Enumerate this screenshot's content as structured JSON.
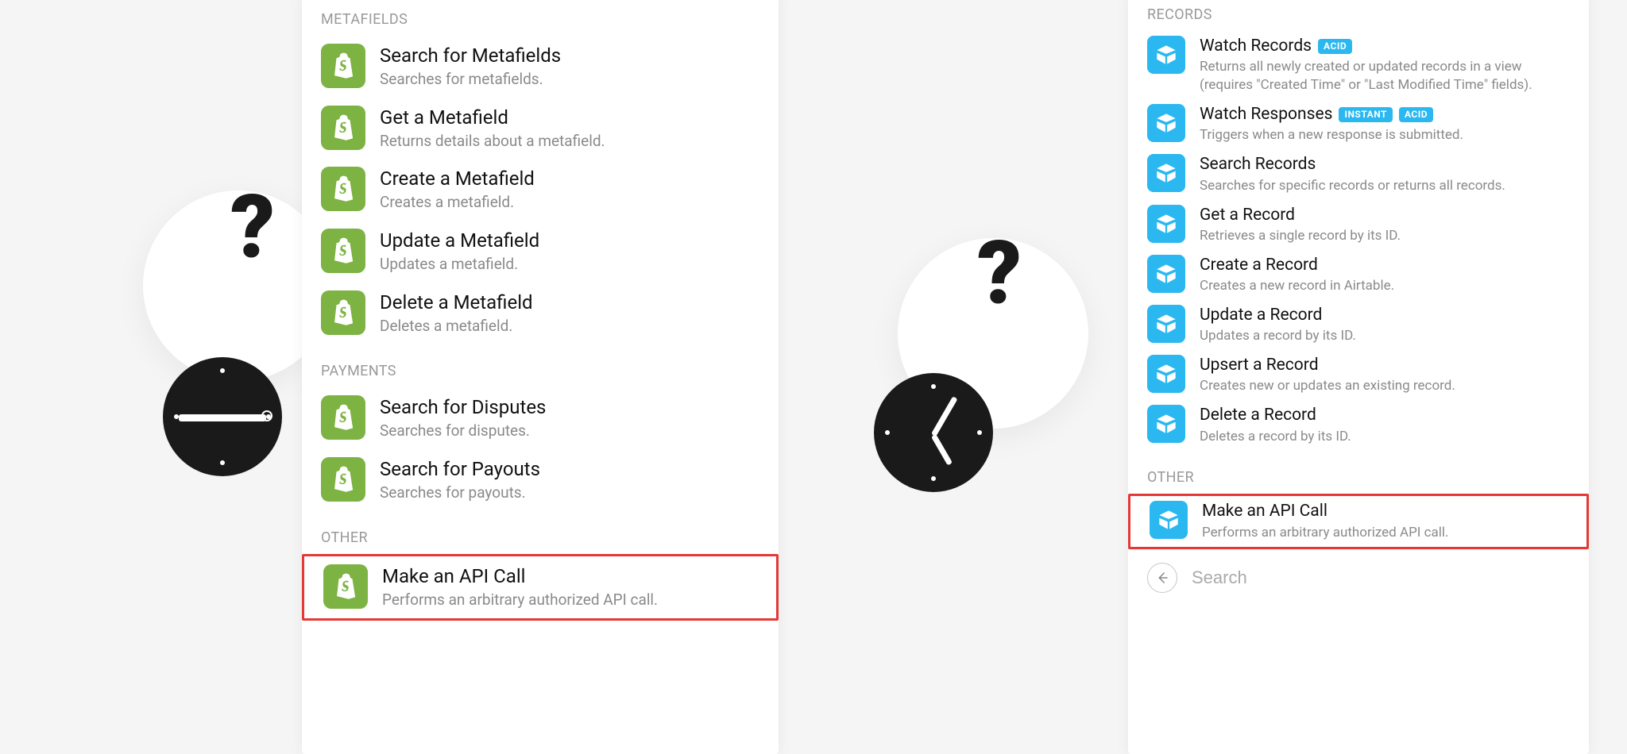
{
  "left_panel": {
    "sections": [
      {
        "label": "METAFIELDS",
        "items": [
          {
            "title": "Search for Metafields",
            "desc": "Searches for metafields."
          },
          {
            "title": "Get a Metafield",
            "desc": "Returns details about a metafield."
          },
          {
            "title": "Create a Metafield",
            "desc": "Creates a metafield."
          },
          {
            "title": "Update a Metafield",
            "desc": "Updates a metafield."
          },
          {
            "title": "Delete a Metafield",
            "desc": "Deletes a metafield."
          }
        ]
      },
      {
        "label": "PAYMENTS",
        "items": [
          {
            "title": "Search for Disputes",
            "desc": "Searches for disputes."
          },
          {
            "title": "Search for Payouts",
            "desc": "Searches for payouts."
          }
        ]
      },
      {
        "label": "OTHER",
        "items": [
          {
            "title": "Make an API Call",
            "desc": "Performs an arbitrary authorized API call.",
            "highlighted": true
          }
        ]
      }
    ]
  },
  "right_panel": {
    "sections": [
      {
        "label": "RECORDS",
        "items": [
          {
            "title": "Watch Records",
            "badges": [
              "ACID"
            ],
            "desc": "Returns all newly created or updated records in a view (requires \"Created Time\" or \"Last Modified Time\" fields)."
          },
          {
            "title": "Watch Responses",
            "badges": [
              "INSTANT",
              "ACID"
            ],
            "desc": "Triggers when a new response is submitted."
          },
          {
            "title": "Search Records",
            "desc": "Searches for specific records or returns all records."
          },
          {
            "title": "Get a Record",
            "desc": "Retrieves a single record by its ID."
          },
          {
            "title": "Create a Record",
            "desc": "Creates a new record in Airtable."
          },
          {
            "title": "Update a Record",
            "desc": "Updates a record by its ID."
          },
          {
            "title": "Upsert a Record",
            "desc": "Creates new or updates an existing record."
          },
          {
            "title": "Delete a Record",
            "desc": "Deletes a record by its ID."
          }
        ]
      },
      {
        "label": "OTHER",
        "items": [
          {
            "title": "Make an API Call",
            "desc": "Performs an arbitrary authorized API call.",
            "highlighted": true
          }
        ]
      }
    ],
    "search_placeholder": "Search"
  }
}
